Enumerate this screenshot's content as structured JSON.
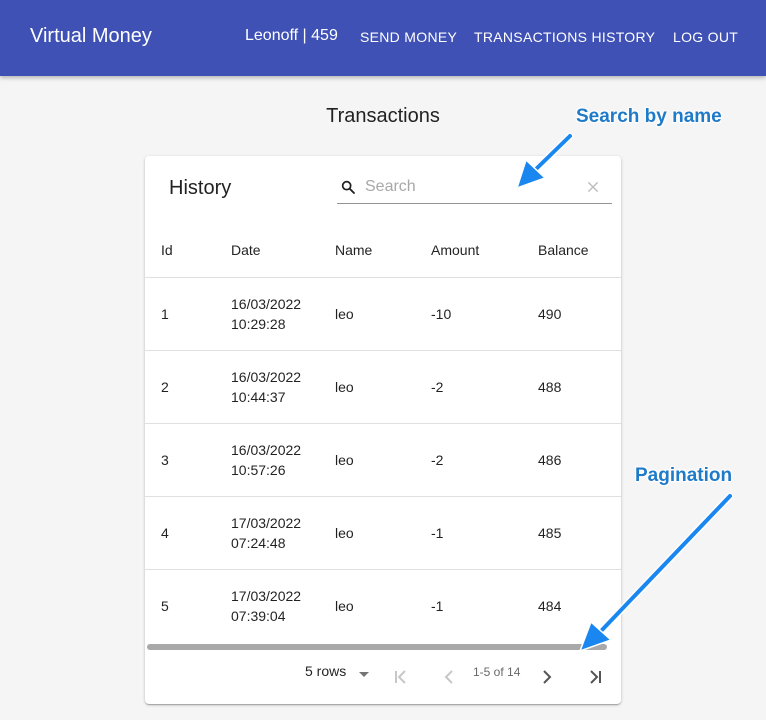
{
  "header": {
    "brand": "Virtual Money",
    "user": "Leonoff | 459",
    "nav": [
      "SEND MONEY",
      "TRANSACTIONS HISTORY",
      "LOG OUT"
    ]
  },
  "page": {
    "title": "Transactions"
  },
  "card": {
    "title": "History",
    "search": {
      "placeholder": "Search",
      "value": ""
    },
    "columns": [
      "Id",
      "Date",
      "Name",
      "Amount",
      "Balance"
    ],
    "rows": [
      {
        "id": "1",
        "date": "16/03/2022",
        "time": "10:29:28",
        "name": "leo",
        "amount": "-10",
        "balance": "490"
      },
      {
        "id": "2",
        "date": "16/03/2022",
        "time": "10:44:37",
        "name": "leo",
        "amount": "-2",
        "balance": "488"
      },
      {
        "id": "3",
        "date": "16/03/2022",
        "time": "10:57:26",
        "name": "leo",
        "amount": "-2",
        "balance": "486"
      },
      {
        "id": "4",
        "date": "17/03/2022",
        "time": "07:24:48",
        "name": "leo",
        "amount": "-1",
        "balance": "485"
      },
      {
        "id": "5",
        "date": "17/03/2022",
        "time": "07:39:04",
        "name": "leo",
        "amount": "-1",
        "balance": "484"
      }
    ],
    "pagination": {
      "rows_per_page": "5 rows",
      "range": "1-5 of 14"
    }
  },
  "annotations": {
    "search": "Search by name",
    "pagination": "Pagination"
  },
  "colors": {
    "appbar": "#3f51b5",
    "annotation": "#1f7ac8",
    "arrow": "#1a87f0"
  }
}
